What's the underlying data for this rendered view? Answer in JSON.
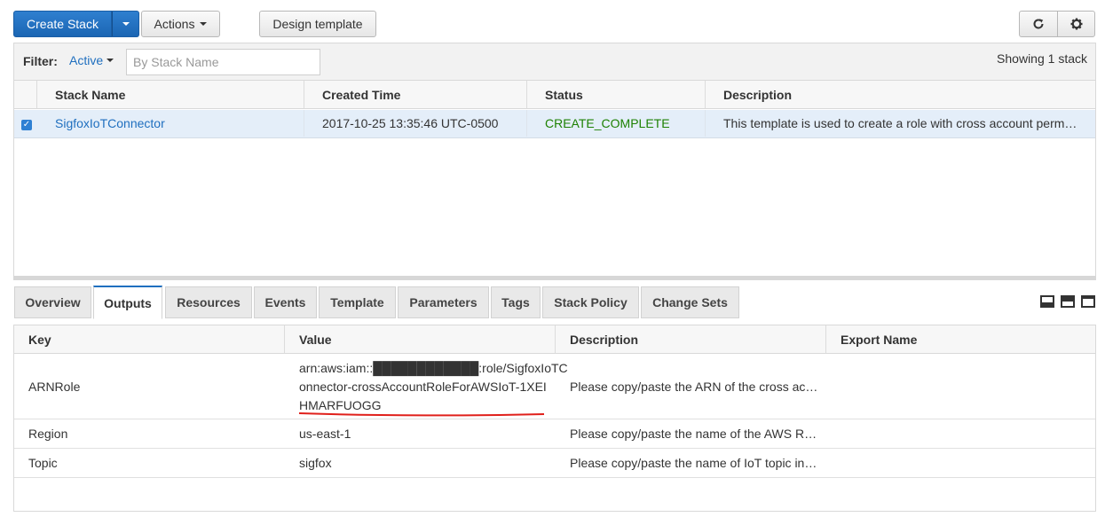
{
  "toolbar": {
    "create_stack_label": "Create Stack",
    "actions_label": "Actions",
    "design_template_label": "Design template"
  },
  "filter": {
    "label": "Filter:",
    "active_value": "Active",
    "search_placeholder": "By Stack Name",
    "showing_text": "Showing 1 stack"
  },
  "stacks": {
    "columns": [
      "Stack Name",
      "Created Time",
      "Status",
      "Description"
    ],
    "rows": [
      {
        "selected": true,
        "name": "SigfoxIoTConnector",
        "created": "2017-10-25 13:35:46 UTC-0500",
        "status": "CREATE_COMPLETE",
        "description": "This template is used to create a role with cross account perm…"
      }
    ]
  },
  "tabs": [
    "Overview",
    "Outputs",
    "Resources",
    "Events",
    "Template",
    "Parameters",
    "Tags",
    "Stack Policy",
    "Change Sets"
  ],
  "active_tab": "Outputs",
  "outputs": {
    "columns": [
      "Key",
      "Value",
      "Description",
      "Export Name"
    ],
    "rows": [
      {
        "key": "ARNRole",
        "value_lines": [
          "arn:aws:iam::████████████:role/SigfoxIoTC",
          "onnector-crossAccountRoleForAWSIoT-1XEI",
          "HMARFUOGG"
        ],
        "description": "Please copy/paste the ARN of the cross ac…",
        "export": ""
      },
      {
        "key": "Region",
        "value": "us-east-1",
        "description": "Please copy/paste the name of the AWS R…",
        "export": ""
      },
      {
        "key": "Topic",
        "value": "sigfox",
        "description": "Please copy/paste the name of IoT topic in…",
        "export": ""
      }
    ]
  },
  "colors": {
    "primary": "#1f6fbf",
    "status_ok": "#1d8102",
    "selected_row": "#e4eef9",
    "annotation": "#e0201b"
  }
}
